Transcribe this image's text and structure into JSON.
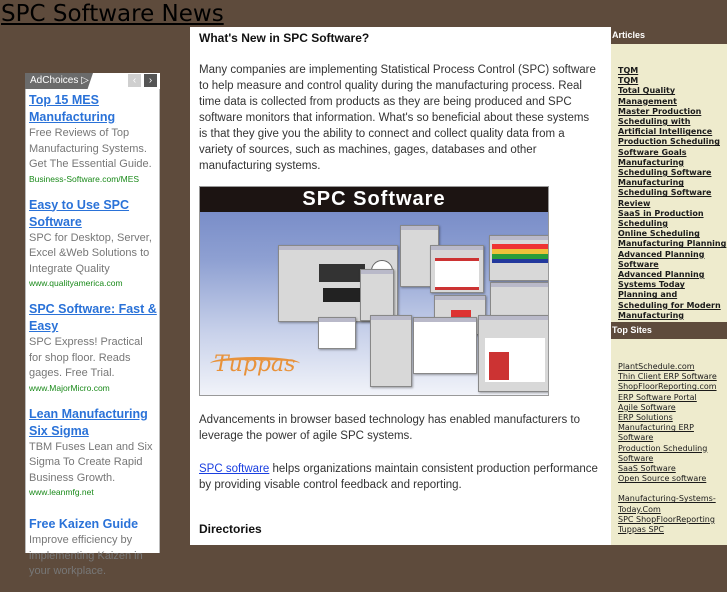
{
  "site": {
    "title": "SPC Software News"
  },
  "ads": {
    "adchoices_label": "AdChoices ▷",
    "prev_icon": "‹",
    "next_icon": "›",
    "items": [
      {
        "title": "Top 15 MES Manufacturing",
        "desc": "Free Reviews of Top Manufacturing Systems. Get The Essential Guide.",
        "url": "Business-Software.com/MES"
      },
      {
        "title": "Easy to Use SPC Software",
        "desc": "SPC for Desktop, Server, Excel &Web Solutions to Integrate Quality",
        "url": "www.qualityamerica.com"
      },
      {
        "title": "SPC Software: Fast & Easy",
        "desc": "SPC Express! Practical for shop floor. Reads gages. Free Trial.",
        "url": "www.MajorMicro.com"
      },
      {
        "title": "Lean Manufacturing Six Sigma",
        "desc": "TBM Fuses Lean and Six Sigma To Create Rapid Business Growth.",
        "url": "www.leanmfg.net"
      },
      {
        "title": "Free Kaizen Guide",
        "desc": "Improve efficiency by implementing Kaizen in your workplace.",
        "url": ""
      }
    ]
  },
  "main": {
    "heading": "What's New in SPC Software?",
    "paragraph1": "Many companies are implementing Statistical Process Control (SPC) software to help measure and control quality during the manufacturing process. Real time data is collected from products as they are being produced and SPC software monitors that information. What's so beneficial about these systems is that they give you the ability to connect and collect quality data from a variety of sources, such as machines, gages, databases and other manufacturing systems.",
    "banner": {
      "title": "SPC  Software",
      "logo": "Tuppas"
    },
    "paragraph2": "Advancements in browser based technology has enabled manufacturers to leverage the power of agile SPC systems.",
    "paragraph3_link": "SPC software",
    "paragraph3_rest": " helps organizations maintain consistent production performance by providing visable control feedback and reporting.",
    "directories_heading": "Directories"
  },
  "sidebar": {
    "articles_heading": "Articles",
    "articles": [
      "TQM",
      "TQM",
      "Total Quality Management",
      "Master Production Scheduling with Artificial Intelligence",
      "Production Scheduling Software Goals",
      "Manufacturing Scheduling Software",
      "Manufacturing Scheduling Software Review",
      "SaaS in Production Scheduling",
      "Online Scheduling",
      "Manufacturing Planning",
      "Advanced Planning Software",
      "Advanced Planning Systems Today",
      "Planning and Scheduling for Modern Manufacturing"
    ],
    "topsites_heading": "Top Sites",
    "topsites": [
      "PlantSchedule.com",
      "Thin Client ERP Software",
      "ShopFloorReporting.com",
      "ERP Software Portal",
      "Agile Software",
      "ERP Solutions",
      "Manufacturing ERP Software",
      "Production Scheduling Software",
      "SaaS Software",
      "Open Source software"
    ],
    "topsites2": [
      "Manufacturing-Systems-Today.Com",
      "SPC ShopFloorReporting",
      "Tuppas SPC"
    ]
  }
}
